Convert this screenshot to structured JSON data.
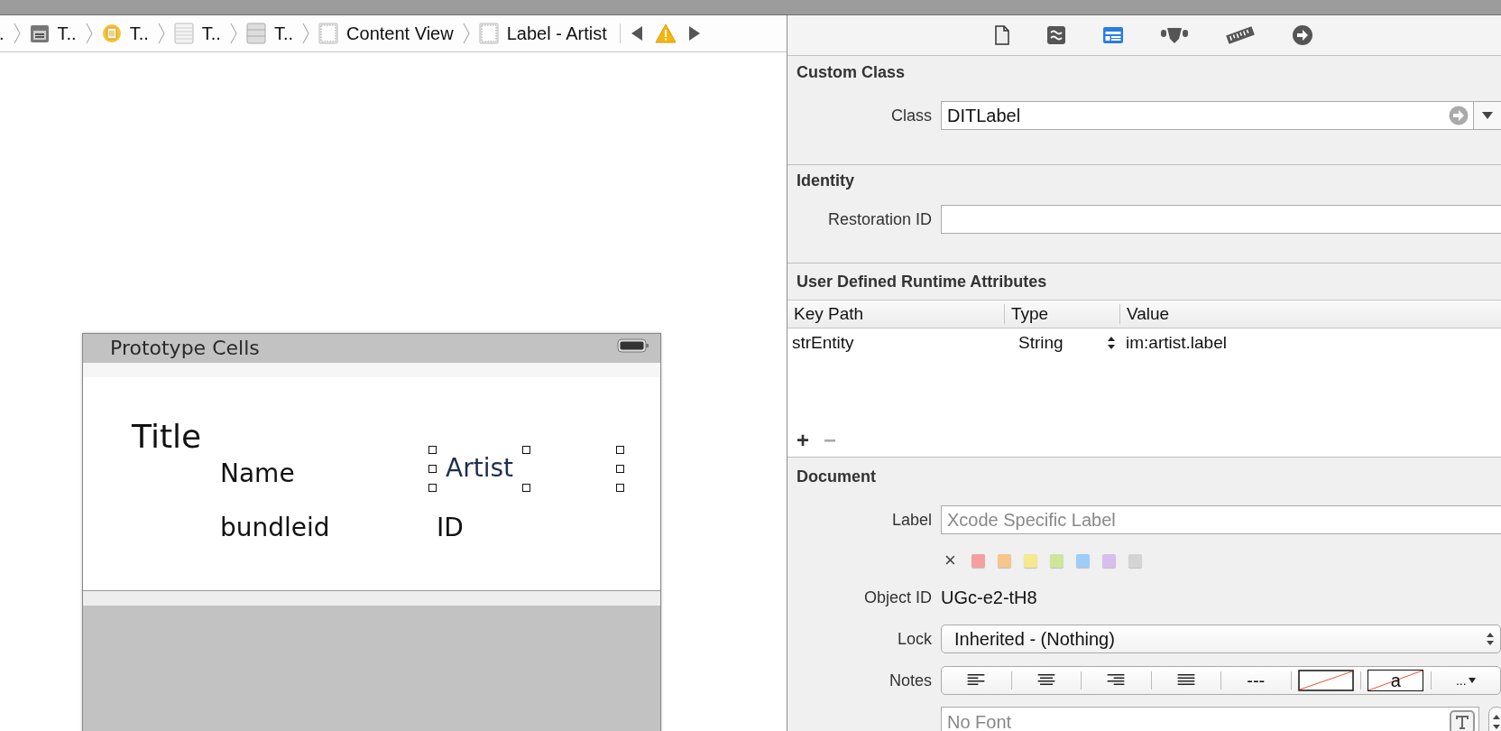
{
  "breadcrumbs": [
    {
      "kind": "none",
      "text": "."
    },
    {
      "kind": "scene",
      "text": "T.."
    },
    {
      "kind": "controller",
      "text": "T.."
    },
    {
      "kind": "table",
      "text": "T.."
    },
    {
      "kind": "cell",
      "text": "T.."
    },
    {
      "kind": "view",
      "text": "Content View"
    },
    {
      "kind": "view",
      "text": "Label - Artist"
    }
  ],
  "inspector_tabs": [
    {
      "kind": "file",
      "selected": false
    },
    {
      "kind": "quick-help",
      "selected": false
    },
    {
      "kind": "identity",
      "selected": true
    },
    {
      "kind": "attributes",
      "selected": false
    },
    {
      "kind": "size",
      "selected": false
    },
    {
      "kind": "connections",
      "selected": false
    }
  ],
  "canvas": {
    "navigation_title": "Prototype Cells",
    "cell_labels": [
      {
        "kind": "title",
        "text": "Title",
        "selected": false
      },
      {
        "kind": "name",
        "text": "Name",
        "selected": false
      },
      {
        "kind": "artist",
        "text": "Artist",
        "selected": true
      },
      {
        "kind": "bundle",
        "text": "bundleid",
        "selected": false
      },
      {
        "kind": "id",
        "text": "ID",
        "selected": false
      }
    ]
  },
  "custom_class": {
    "header": "Custom Class",
    "class_label": "Class",
    "class_value": "DITLabel"
  },
  "identity": {
    "header": "Identity",
    "restoration_label": "Restoration ID"
  },
  "runtime_attributes": {
    "header": "User Defined Runtime Attributes",
    "columns": [
      "Key Path",
      "Type",
      "Value"
    ],
    "rows": [
      {
        "key_path": "strEntity",
        "type": "String",
        "value": "im:artist.label"
      }
    ],
    "add": "+",
    "remove": "−"
  },
  "document": {
    "header": "Document",
    "label_label": "Label",
    "label_placeholder": "Xcode Specific Label",
    "clear_mark": "×",
    "label_colors": [
      {
        "color": "#f4a0a0"
      },
      {
        "color": "#f7c68c"
      },
      {
        "color": "#f4e98c"
      },
      {
        "color": "#cfe69a"
      },
      {
        "color": "#9fcdf7"
      },
      {
        "color": "#d9bdeb"
      },
      {
        "color": "#d4d4d4"
      }
    ],
    "object_id_label": "Object ID",
    "object_id": "UGc-e2-tH8",
    "lock_label": "Lock",
    "lock_value": "Inherited - (Nothing)",
    "notes_label": "Notes",
    "notes_buttons": [
      {
        "kind": "align-left"
      },
      {
        "kind": "align-center"
      },
      {
        "kind": "align-right"
      },
      {
        "kind": "justify"
      },
      {
        "kind": "text",
        "text": "---"
      },
      {
        "kind": "no-color"
      },
      {
        "kind": "no-color-text",
        "text": "a"
      },
      {
        "kind": "more",
        "text": "..."
      }
    ],
    "font_placeholder": "No Font"
  }
}
